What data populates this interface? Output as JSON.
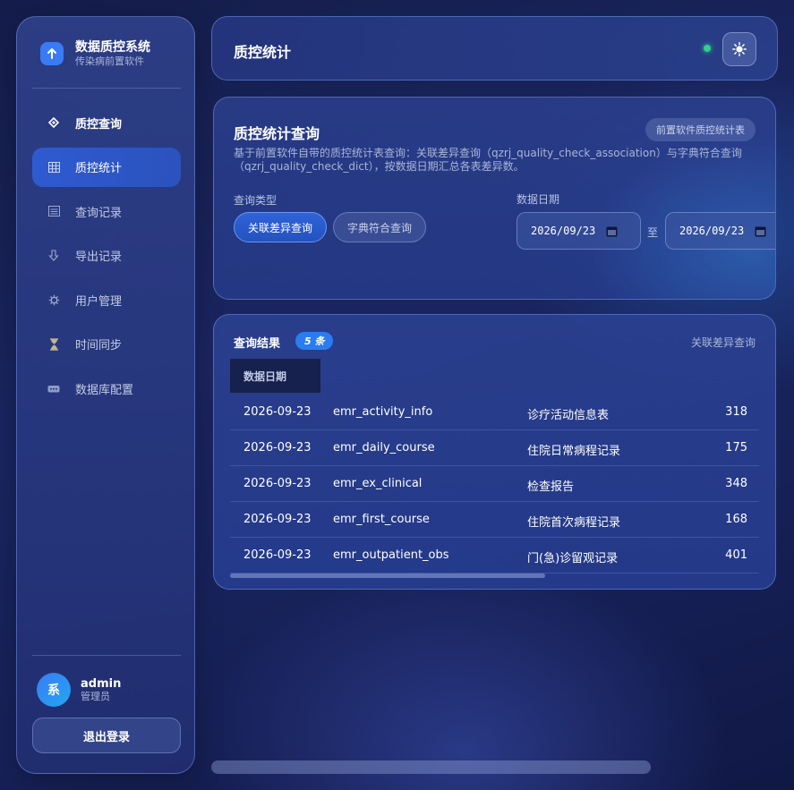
{
  "app": {
    "title": "数据质控系统",
    "subtitle": "传染病前置软件"
  },
  "sidebar": {
    "items": [
      {
        "label": "质控查询",
        "icon": "diamond-icon",
        "active": false
      },
      {
        "label": "质控统计",
        "icon": "grid-icon",
        "active": true
      },
      {
        "label": "查询记录",
        "icon": "list-icon",
        "active": false
      },
      {
        "label": "导出记录",
        "icon": "download-icon",
        "active": false
      },
      {
        "label": "用户管理",
        "icon": "gear-icon",
        "active": false
      },
      {
        "label": "时间同步",
        "icon": "hourglass-icon",
        "active": false
      },
      {
        "label": "数据库配置",
        "icon": "database-icon",
        "active": false
      }
    ]
  },
  "user": {
    "avatar_char": "系",
    "name": "admin",
    "role": "管理员",
    "logout_label": "退出登录"
  },
  "header": {
    "title": "质控统计",
    "status": "online"
  },
  "query": {
    "title": "质控统计查询",
    "tag": "前置软件质控统计表",
    "description": "基于前置软件自带的质控统计表查询：关联差异查询（qzrj_quality_check_association）与字典符合查询（qzrj_quality_check_dict），按数据日期汇总各表差异数。",
    "type_label": "查询类型",
    "types": [
      "关联差异查询",
      "字典符合查询"
    ],
    "selected_type": "关联差异查询",
    "date_label": "数据日期",
    "date_from": "2026/09/23",
    "date_to": "2026/09/23",
    "date_separator": "至"
  },
  "results": {
    "title": "查询结果",
    "count_badge": "5 条",
    "query_type": "关联差异查询",
    "columns": [
      "数据日期"
    ],
    "rows": [
      {
        "date": "2026-09-23",
        "table": "emr_activity_info",
        "name": "诊疗活动信息表",
        "count": "318"
      },
      {
        "date": "2026-09-23",
        "table": "emr_daily_course",
        "name": "住院日常病程记录",
        "count": "175"
      },
      {
        "date": "2026-09-23",
        "table": "emr_ex_clinical",
        "name": "检查报告",
        "count": "348"
      },
      {
        "date": "2026-09-23",
        "table": "emr_first_course",
        "name": "住院首次病程记录",
        "count": "168"
      },
      {
        "date": "2026-09-23",
        "table": "emr_outpatient_obs",
        "name": "门(急)诊留观记录",
        "count": "401"
      }
    ]
  },
  "colors": {
    "accent": "#3a7bf5",
    "status_online": "#2fd08a",
    "badge": "#2a7df0"
  }
}
